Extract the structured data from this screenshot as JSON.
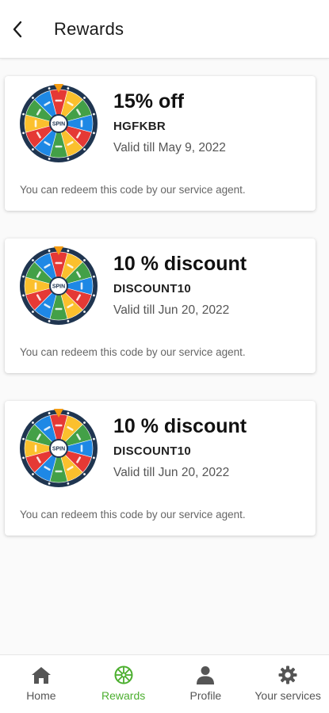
{
  "header": {
    "title": "Rewards",
    "back_icon": "back-arrow-icon"
  },
  "rewards": [
    {
      "title": "15% off",
      "code": "HGFKBR",
      "valid": "Valid till May 9, 2022",
      "note": "You can redeem this code by our service agent.",
      "image": "spin-wheel-icon"
    },
    {
      "title": "10 % discount",
      "code": "DISCOUNT10",
      "valid": "Valid till Jun 20, 2022",
      "note": "You can redeem this code by our service agent.",
      "image": "spin-wheel-icon"
    },
    {
      "title": "10 % discount",
      "code": "DISCOUNT10",
      "valid": "Valid till Jun 20, 2022",
      "note": "You can redeem this code by our service agent.",
      "image": "spin-wheel-icon"
    }
  ],
  "bottom_nav": {
    "items": [
      {
        "label": "Home",
        "icon": "home-icon",
        "active": false
      },
      {
        "label": "Rewards",
        "icon": "wheel-icon",
        "active": true
      },
      {
        "label": "Profile",
        "icon": "person-icon",
        "active": false
      },
      {
        "label": "Your services",
        "icon": "gear-icon",
        "active": false
      }
    ]
  },
  "colors": {
    "accent": "#4caf2f",
    "text_primary": "#111111",
    "text_secondary": "#555555",
    "wheel_red": "#e53935",
    "wheel_yellow": "#fbc02d",
    "wheel_green": "#43a047",
    "wheel_blue": "#1e88e5",
    "wheel_rim": "#1f3550",
    "pointer": "#f59c12"
  },
  "wheel_label": "SPIN"
}
